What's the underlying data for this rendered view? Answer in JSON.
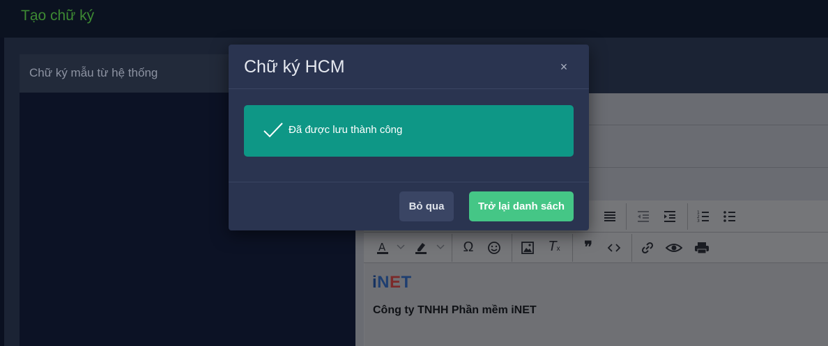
{
  "page": {
    "title": "Tạo chữ ký"
  },
  "left_card": {
    "title": "Chữ ký mẫu từ hệ thống"
  },
  "editor": {
    "toolbar_row1": [
      "align-justify-icon",
      "outdent-icon",
      "indent-icon",
      "numbered-list-icon",
      "bulleted-list-icon"
    ],
    "toolbar_row2": [
      "text-color-icon",
      "highlight-color-icon",
      "special-char-icon",
      "emoji-icon",
      "image-icon",
      "clear-format-icon",
      "blockquote-icon",
      "code-icon",
      "link-icon",
      "preview-icon",
      "print-icon"
    ],
    "logo_parts": {
      "i": "i",
      "n": "N",
      "e": "E",
      "t": "T"
    },
    "company": "Công ty TNHH Phần mềm iNET"
  },
  "modal": {
    "title": "Chữ ký HCM",
    "close_label": "×",
    "alert": "Đã được lưu thành công",
    "skip_label": "Bỏ qua",
    "back_label": "Trở lại danh sách"
  },
  "colors": {
    "modal_bg": "#2a3450",
    "alert_bg": "#0e9786",
    "primary_btn": "#45c686",
    "secondary_btn": "#3a4564",
    "page_title": "#3d8a33"
  }
}
